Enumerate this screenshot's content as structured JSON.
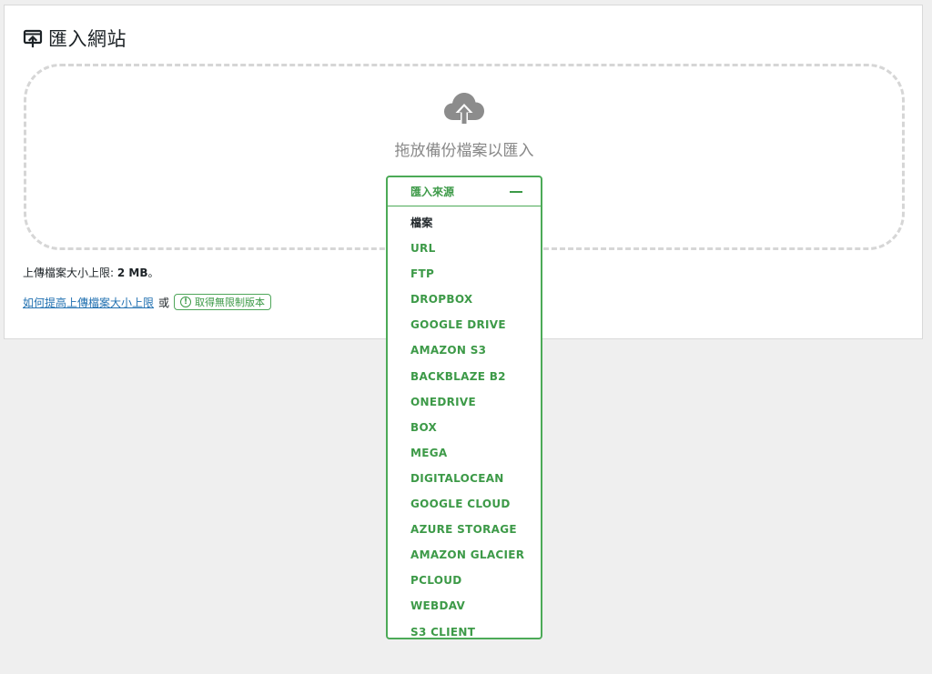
{
  "page": {
    "title": "匯入網站",
    "title_icon": "import-site-icon"
  },
  "dropzone": {
    "icon": "cloud-upload-icon",
    "text": "拖放備份檔案以匯入"
  },
  "upload_limit": {
    "label": "上傳檔案大小上限: ",
    "value": "2 MB",
    "suffix": "。"
  },
  "help": {
    "link_text": "如何提高上傳檔案大小上限",
    "or_text": "或",
    "unlimited_label": "取得無限制版本",
    "unlimited_icon": "exclamation-circle-icon"
  },
  "import_source": {
    "label": "匯入來源",
    "toggle_icon": "minus-icon",
    "items": [
      "檔案",
      "URL",
      "FTP",
      "DROPBOX",
      "GOOGLE DRIVE",
      "AMAZON S3",
      "BACKBLAZE B2",
      "ONEDRIVE",
      "BOX",
      "MEGA",
      "DIGITALOCEAN",
      "GOOGLE CLOUD",
      "AZURE STORAGE",
      "AMAZON GLACIER",
      "PCLOUD",
      "WEBDAV",
      "S3 CLIENT"
    ]
  },
  "colors": {
    "accent_green": "#3d9a48",
    "link_blue": "#2271b1",
    "dashed_border": "#d6d6d6",
    "background": "#efefef"
  }
}
